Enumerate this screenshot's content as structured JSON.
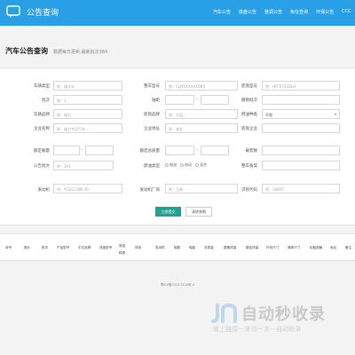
{
  "header": {
    "title": "公告查询",
    "nav": [
      "汽车公告",
      "底盘公告",
      "整调公告",
      "免征查询",
      "环保公告",
      "CCC"
    ]
  },
  "page": {
    "title": "汽车公告查询",
    "subtitle": "数据每日更新,最新批次384"
  },
  "form": {
    "vehicle_type": {
      "label": "车辆类型",
      "placeholder": "例：厢式车"
    },
    "vehicle_model": {
      "label": "整车型号",
      "placeholder": "例：CLW5XXXXXDB5"
    },
    "chassis_model": {
      "label": "底盘型号",
      "placeholder": "例：HFF6751DLH"
    },
    "batch": {
      "label": "批次",
      "placeholder": "例：2"
    },
    "wheelbase": {
      "label": "轴距",
      "placeholder": ""
    },
    "pending": {
      "label": "撤销批次",
      "placeholder": ""
    },
    "brand": {
      "label": "车辆品牌",
      "placeholder": "例：福力"
    },
    "chassis_brand": {
      "label": "底盘品牌",
      "placeholder": "例：大运..."
    },
    "fuel": {
      "label": "燃油种类",
      "selected": "不限"
    },
    "company": {
      "label": "企业名称",
      "placeholder": "例：福力专用汽车..."
    },
    "company_addr": {
      "label": "企业地址",
      "placeholder": "例：湖北"
    },
    "chassis_company": {
      "label": "底盘企业",
      "placeholder": ""
    },
    "rated_weight": {
      "label": "额定载量",
      "placeholder": ""
    },
    "total_weight": {
      "label": "额定总质量",
      "placeholder": ""
    },
    "seats": {
      "label": "载客数",
      "placeholder": ""
    },
    "notice_no": {
      "label": "公告批文",
      "placeholder": "例：293"
    },
    "eco": {
      "label": "燃油类型",
      "options": [
        "燃油",
        "电动",
        "混合"
      ]
    },
    "remark": {
      "label": "整车备案",
      "placeholder": ""
    },
    "engine": {
      "label": "发动机",
      "placeholder": "例：YC6G230N-30"
    },
    "engine_maker": {
      "label": "发动机厂商",
      "placeholder": "例：玉柴"
    },
    "vin": {
      "label": "识别代码",
      "placeholder": "例：LBDVT"
    },
    "submit": "立即提交",
    "reset": "清除参数"
  },
  "table": {
    "columns": [
      "序号",
      "图片",
      "批次",
      "产品型号",
      "中文品牌",
      "底盘型号",
      "燃油种类",
      "排放",
      "发动机",
      "轴数",
      "轴距",
      "总质量",
      "整备质量",
      "额定质量",
      "外形尺寸",
      "厢体尺寸",
      "轮胎规格",
      "免征",
      "备注"
    ]
  },
  "footer": {
    "text": "鄂ICP备12017428号-4"
  },
  "watermark": {
    "title": "自动秒收录",
    "subtitle": "做上链接---来访一次---自动收录"
  },
  "colors": {
    "header_bg": "#29a0e6",
    "submit_bg": "#1fa391",
    "page_bg": "#f3f3f3"
  }
}
